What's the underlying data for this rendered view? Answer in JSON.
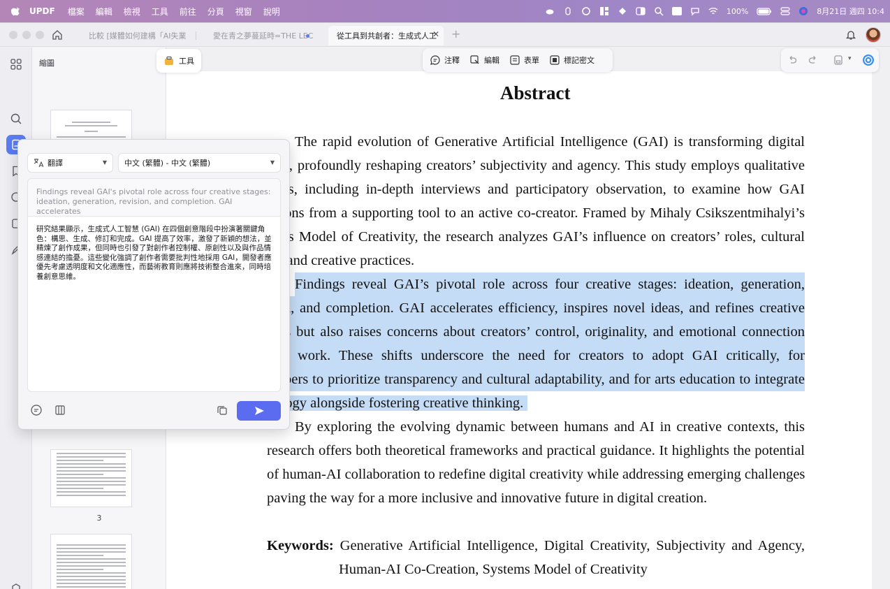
{
  "menubar": {
    "app_name": "UPDF",
    "items": [
      "檔案",
      "編輯",
      "檢視",
      "工具",
      "前往",
      "分頁",
      "視窗",
      "說明"
    ],
    "battery": "100%",
    "datetime": "8月21日 週四 10:4"
  },
  "tabs": [
    {
      "label": "比較 [媒體如何建構「AI失業",
      "active": false
    },
    {
      "label": "愛在青之夢蔓延時=THE LEC",
      "active": false
    },
    {
      "label": "從工具到共創者：生成式人工",
      "active": true
    }
  ],
  "thumbnails": {
    "title": "縮圖",
    "page_numbers": [
      "3"
    ]
  },
  "tools_button": "工具",
  "toolbar": {
    "comment": "注釋",
    "edit": "編輯",
    "form": "表單",
    "redact": "標記密文"
  },
  "translate_popup": {
    "mode": "翻譯",
    "language_pair": "中文 (繁體) - 中文 (繁體)",
    "source_text": "Findings reveal GAI's pivotal role across four creative stages: ideation, generation, revision, and completion. GAI accelerates",
    "result_text": "研究結果顯示，生成式人工智慧 (GAI) 在四個創意階段中扮演著關鍵角色：構思、生成、修訂和完成。GAI 提高了效率，激發了新穎的想法，並精煉了創作成果，但同時也引發了對創作者控制權、原創性以及與作品情感連結的擔憂。這些變化強調了創作者需要批判性地採用 GAI，開發者應優先考慮透明度和文化適應性，而藝術教育則應將技術整合進來，同時培養創意思維。"
  },
  "document": {
    "title": "Abstract",
    "paragraph1": [
      "The rapid evolution of Generative Artificial Intelligence (GAI) is transforming digital",
      "tion, profoundly reshaping creators’ subjectivity and agency. This study employs qualitative",
      "hods, including in-depth interviews and participatory observation, to examine how GAI",
      "sitions from a supporting tool to an active co-creator. Framed by Mihaly Csikszentmihalyi’s",
      "tems Model of Creativity, the research analyzes GAI’s influence on creators’ roles, cultural",
      "ns, and creative practices."
    ],
    "paragraph2": [
      "Findings reveal GAI’s pivotal role across four creative stages: ideation, generation,",
      "sion, and completion. GAI accelerates efficiency, inspires novel ideas, and refines creative",
      "puts but also raises concerns about creators’ control, originality, and emotional connection",
      "heir work. These shifts underscore the need for creators to adopt GAI critically, for",
      "elopers to prioritize transparency and cultural adaptability, and for arts education to integrate",
      "nology alongside fostering creative thinking."
    ],
    "paragraph3": [
      "By exploring the evolving dynamic between humans and AI in creative contexts, this",
      "research offers both theoretical frameworks and practical guidance. It highlights the potential",
      "of human-AI collaboration to redefine digital creativity while addressing emerging challenges,",
      "paving the way for a more inclusive and innovative future in digital creation."
    ],
    "keywords_label": "Keywords:",
    "keywords_line1": "Generative Artificial Intelligence, Digital Creativity, Subjectivity and Agency,",
    "keywords_line2": "Human-AI Co-Creation, Systems Model of Creativity"
  },
  "colors": {
    "accent": "#5b6cf0",
    "highlight": "#c5dcf6"
  }
}
